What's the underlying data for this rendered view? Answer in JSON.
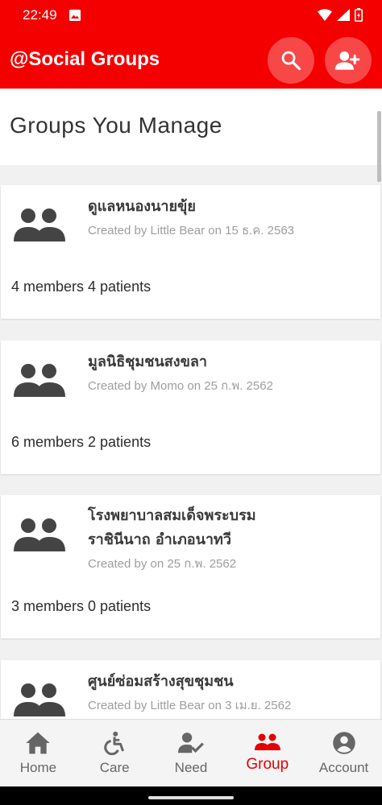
{
  "status_bar": {
    "time": "22:49"
  },
  "app_bar": {
    "title": "@Social Groups"
  },
  "heading": "Groups You Manage",
  "groups": [
    {
      "name": "ดูแลหนองนายขุ้ย",
      "created": "Created by Little Bear on 15 ธ.ค. 2563",
      "stats": "4 members 4 patients"
    },
    {
      "name": "มูลนิธิชุมชนสงขลา",
      "created": "Created by Momo on 25 ก.พ. 2562",
      "stats": "6 members 2 patients"
    },
    {
      "name_line1": "โรงพยาบาลสมเด็จพระบรม",
      "name_line2": "ราชินีนาถ อำเภอนาทวี",
      "created": "Created by  on 25 ก.พ. 2562",
      "stats": "3 members 0 patients"
    },
    {
      "name": "ศูนย์ซ่อมสร้างสุขชุมชน",
      "created": "Created by Little Bear on 3 เม.ย. 2562"
    }
  ],
  "nav": [
    {
      "label": "Home",
      "icon": "home-icon"
    },
    {
      "label": "Care",
      "icon": "accessibility-icon"
    },
    {
      "label": "Need",
      "icon": "person-check-icon"
    },
    {
      "label": "Group",
      "icon": "group-icon",
      "active": true
    },
    {
      "label": "Account",
      "icon": "account-circle-icon"
    }
  ],
  "colors": {
    "brand": "#f40000",
    "active": "#e60000",
    "icon_gray": "#444444"
  }
}
